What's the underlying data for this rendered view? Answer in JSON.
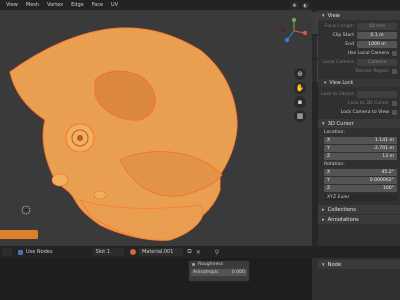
{
  "menubar": {
    "items": [
      "View",
      "Mesh",
      "Vertex",
      "Edge",
      "Face",
      "UV"
    ]
  },
  "npanel": {
    "view": {
      "title": "View",
      "focal_length_label": "Focal Length",
      "focal_length": "50 mm",
      "clip_start_label": "Clip Start",
      "clip_start": "0.1 m",
      "end_label": "End",
      "end": "1000 m",
      "use_local_camera": "Use Local Camera",
      "local_camera_label": "Local Camera",
      "local_camera": "Camera",
      "render_region": "Render Region",
      "view_lock_title": "View Lock",
      "lock_to_object_label": "Lock to Object",
      "lock_to_3d_cursor": "Lock to 3D Cursor",
      "lock_camera_to_view": "Lock Camera to View"
    },
    "cursor": {
      "title": "3D Cursor",
      "location_label": "Location:",
      "location": [
        {
          "axis": "X",
          "value": "1.141 m"
        },
        {
          "axis": "Y",
          "value": "-2.701 m"
        },
        {
          "axis": "Z",
          "value": "13 m"
        }
      ],
      "rotation_label": "Rotation:",
      "rotation": [
        {
          "axis": "X",
          "value": "45.2°"
        },
        {
          "axis": "Y",
          "value": "0.000062°"
        },
        {
          "axis": "Z",
          "value": "100°"
        }
      ],
      "euler": "XYZ Euler"
    },
    "collections": "Collections",
    "annotations": "Annotations"
  },
  "node_editor": {
    "use_nodes": "Use Nodes",
    "slot": "Slot 1",
    "material": "Material.001",
    "sockets": [
      "Roughness",
      "Anisotropic",
      "0.000"
    ],
    "panel_title": "Node"
  },
  "colors": {
    "mesh_fill": "#e8a152",
    "mesh_wire": "#ff7a30",
    "selection": "#e8912f"
  }
}
